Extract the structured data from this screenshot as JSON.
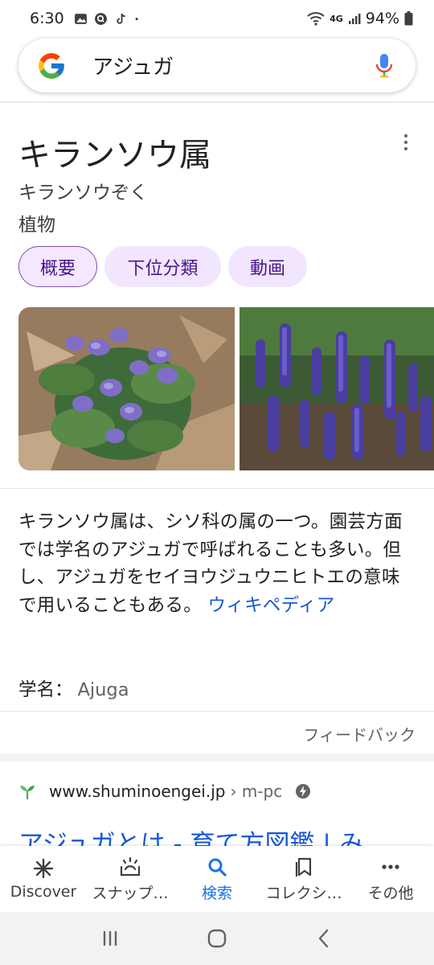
{
  "status_bar": {
    "time": "6:30",
    "network": "4G",
    "battery": "94%"
  },
  "search": {
    "query": "アジュガ"
  },
  "knowledge_panel": {
    "title": "キランソウ属",
    "reading": "キランソウぞく",
    "type": "植物",
    "chips": [
      "概要",
      "下位分類",
      "動画"
    ],
    "description": "キランソウ属は、シソ科の属の一つ。園芸方面では学名のアジュガで呼ばれることも多い。但し、アジュガをセイヨウジュウニヒトエの意味で用いることもある。",
    "wiki_link": "ウィキペディア",
    "scientific_name_label": "学名：",
    "scientific_name_value": "Ajuga",
    "feedback": "フィードバック"
  },
  "result": {
    "domain": "www.shuminoengei.jp",
    "path": "› m-pc",
    "title": "アジュガとは - 育て方図鑑 | み"
  },
  "bottom_nav": {
    "items": [
      {
        "label": "Discover",
        "icon": "asterisk-icon"
      },
      {
        "label": "スナップ…",
        "icon": "snapshot-icon"
      },
      {
        "label": "検索",
        "icon": "search-icon"
      },
      {
        "label": "コレクシ…",
        "icon": "collections-icon"
      },
      {
        "label": "その他",
        "icon": "more-icon"
      }
    ],
    "active_index": 2
  },
  "colors": {
    "link": "#1558d6",
    "chip_bg": "#f1e6fd",
    "chip_text": "#4a148c",
    "active_nav": "#1a73e8"
  }
}
